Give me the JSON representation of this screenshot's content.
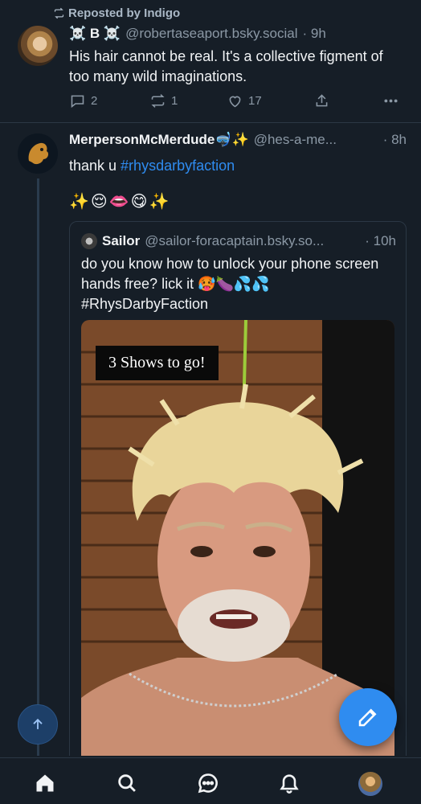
{
  "post1": {
    "repost_label": "Reposted by Indigo",
    "display_name": "☠️ B ☠️",
    "handle": "@robertaseaport.bsky.social",
    "time": "· 9h",
    "text": "His hair cannot be real. It's a collective figment of too many wild imaginations.",
    "replies": "2",
    "reposts": "1",
    "likes": "17"
  },
  "post2": {
    "display_name": "MerpersonMcMerdude🤿✨",
    "handle": "@hes-a-me...",
    "time": "· 8h",
    "text_prefix": "thank u ",
    "hashtag": "#rhysdarbyfaction",
    "emoji_line": "✨😌👄😋✨",
    "quote": {
      "display_name": "Sailor",
      "handle": "@sailor-foracaptain.bsky.so...",
      "time": "· 10h",
      "text": "do you know how to unlock your phone screen hands free? lick it 🥵🍆💦💦 #RhysDarbyFaction",
      "image_caption": "3 Shows to go!"
    }
  },
  "icons": {
    "repost": "repost-icon",
    "reply": "reply-icon",
    "like": "heart-icon",
    "share": "share-icon",
    "more": "more-icon",
    "scroll_top": "arrow-up-icon",
    "compose": "compose-icon",
    "nav": [
      "home-icon",
      "search-icon",
      "chat-icon",
      "bell-icon",
      "avatar"
    ]
  },
  "colors": {
    "background": "#161e27",
    "accent": "#2f8cf0",
    "muted_text": "#8b98a5"
  }
}
